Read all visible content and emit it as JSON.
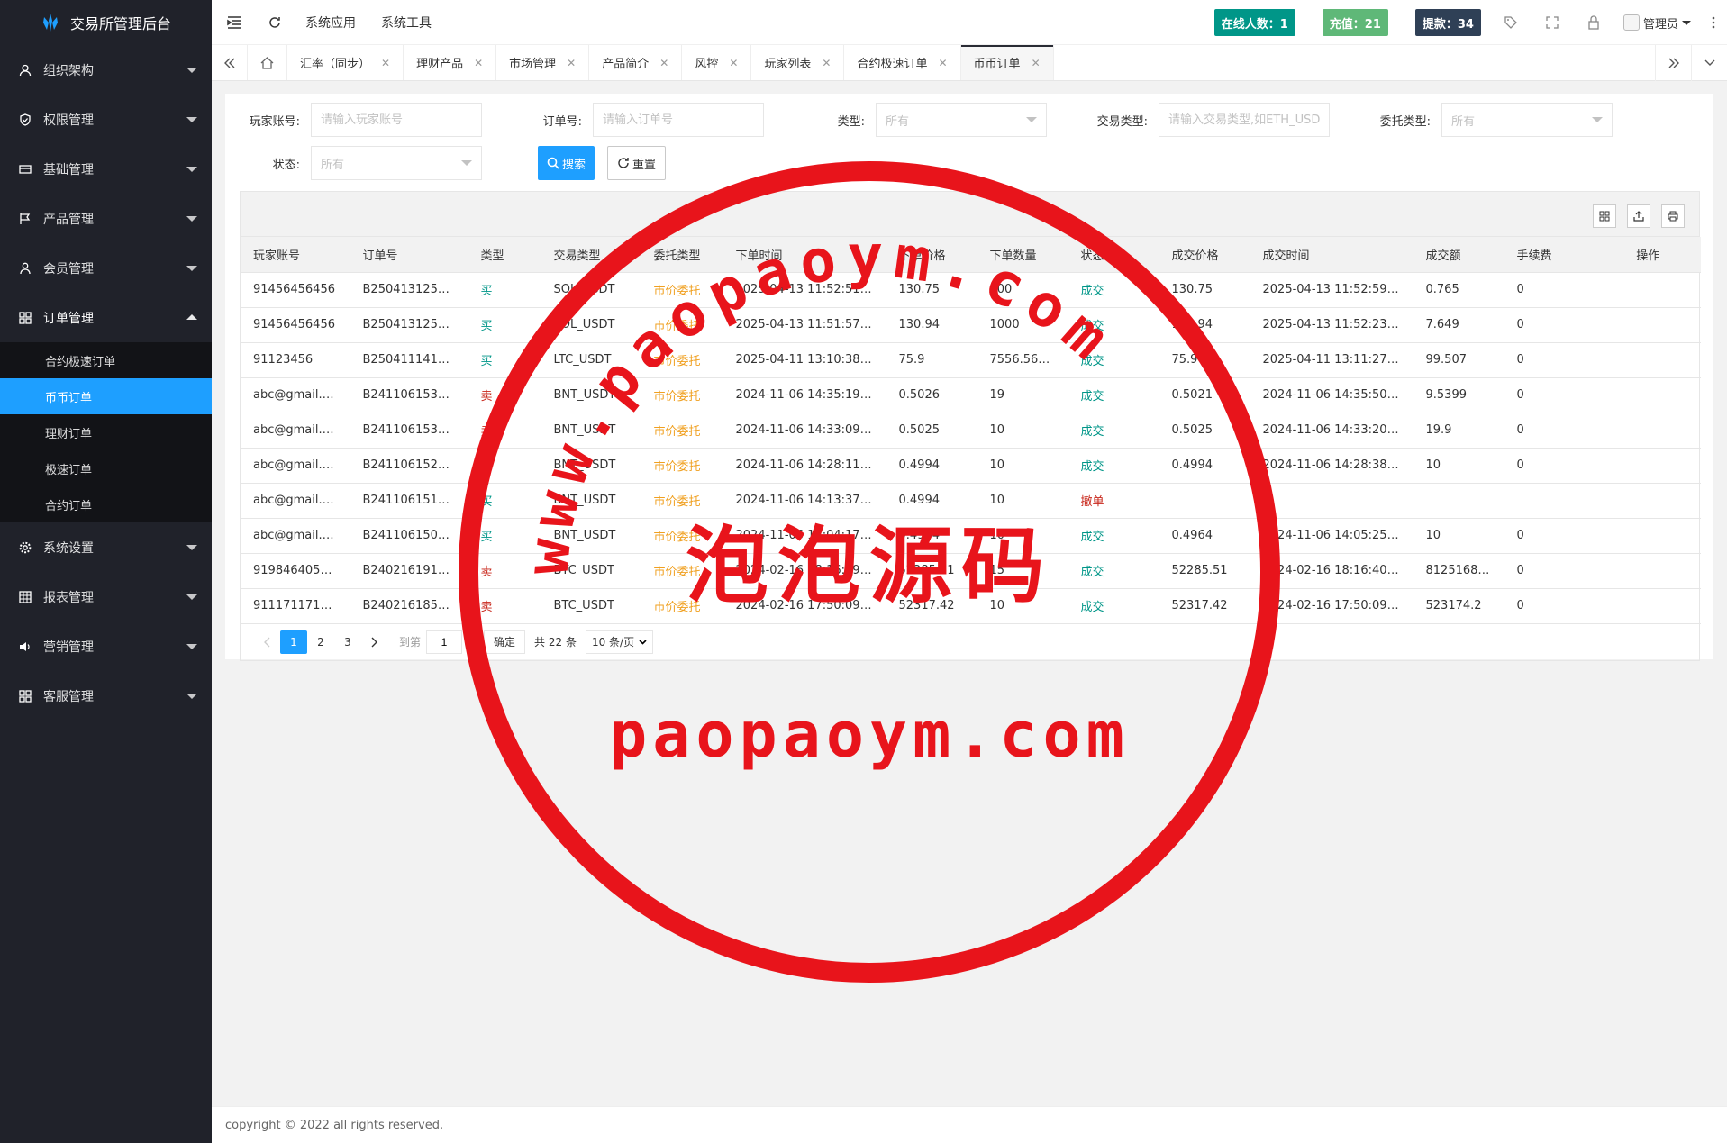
{
  "app": {
    "title": "交易所管理后台"
  },
  "sidebar": {
    "groups": [
      {
        "label": "组织架构",
        "icon": "user-icon"
      },
      {
        "label": "权限管理",
        "icon": "shield-icon"
      },
      {
        "label": "基础管理",
        "icon": "card-icon"
      },
      {
        "label": "产品管理",
        "icon": "flag-icon"
      },
      {
        "label": "会员管理",
        "icon": "person-icon"
      },
      {
        "label": "订单管理",
        "icon": "apps-icon",
        "open": true,
        "children": [
          "合约极速订单",
          "币币订单",
          "理财订单",
          "极速订单",
          "合约订单"
        ],
        "active_child": "币币订单"
      },
      {
        "label": "系统设置",
        "icon": "gear-icon"
      },
      {
        "label": "报表管理",
        "icon": "grid-icon"
      },
      {
        "label": "营销管理",
        "icon": "speaker-icon"
      },
      {
        "label": "客服管理",
        "icon": "apps-icon"
      }
    ]
  },
  "header": {
    "menu1": "系统应用",
    "menu2": "系统工具",
    "online": "在线人数：1",
    "recharge": "充值：21",
    "withdraw": "提款：34",
    "user": "管理员",
    "colors": {
      "online": "#009688",
      "recharge": "#5fb878",
      "withdraw": "#2f4056"
    }
  },
  "tabs": [
    {
      "label": "汇率（同步）"
    },
    {
      "label": "理财产品"
    },
    {
      "label": "市场管理"
    },
    {
      "label": "产品简介"
    },
    {
      "label": "风控"
    },
    {
      "label": "玩家列表"
    },
    {
      "label": "合约极速订单"
    },
    {
      "label": "币币订单",
      "active": true
    }
  ],
  "form": {
    "player_label": "玩家账号:",
    "player_placeholder": "请输入玩家账号",
    "order_label": "订单号:",
    "order_placeholder": "请输入订单号",
    "type_label": "类型:",
    "type_value": "所有",
    "trade_label": "交易类型:",
    "trade_placeholder": "请输入交易类型,如ETH_USDT",
    "entrust_label": "委托类型:",
    "entrust_value": "所有",
    "status_label": "状态:",
    "status_value": "所有",
    "search_btn": "搜索",
    "reset_btn": "重置"
  },
  "table": {
    "columns": [
      "玩家账号",
      "订单号",
      "类型",
      "交易类型",
      "委托类型",
      "下单时间",
      "下单价格",
      "下单数量",
      "状态",
      "成交价格",
      "成交时间",
      "成交额",
      "手续费",
      "操作"
    ],
    "rows": [
      [
        "91456456456",
        "B250413125…",
        "买",
        "SOL_USDT",
        "市价委托",
        "2025-04-13 11:52:51.…",
        "130.75",
        "100",
        "成交",
        "130.75",
        "2025-04-13 11:52:59.…",
        "0.765",
        "0"
      ],
      [
        "91456456456",
        "B250413125…",
        "买",
        "SOL_USDT",
        "市价委托",
        "2025-04-13 11:51:57.…",
        "130.94",
        "1000",
        "成交",
        "130.94",
        "2025-04-13 11:52:23.…",
        "7.649",
        "0"
      ],
      [
        "91123456",
        "B2504111410…",
        "买",
        "LTC_USDT",
        "市价委托",
        "2025-04-11 13:10:38.…",
        "75.9",
        "7556.56…",
        "成交",
        "75.9",
        "2025-04-11 13:11:27.…",
        "99.507",
        "0"
      ],
      [
        "abc@gmail.…",
        "B241106153…",
        "卖",
        "BNT_USDT",
        "市价委托",
        "2024-11-06 14:35:19.…",
        "0.5026",
        "19",
        "成交",
        "0.5021",
        "2024-11-06 14:35:50.…",
        "9.5399",
        "0"
      ],
      [
        "abc@gmail.…",
        "B241106153…",
        "卖",
        "BNT_USDT",
        "市价委托",
        "2024-11-06 14:33:09.…",
        "0.5025",
        "10",
        "成交",
        "0.5025",
        "2024-11-06 14:33:20.…",
        "19.9",
        "0"
      ],
      [
        "abc@gmail.…",
        "B241106152…",
        "买",
        "BNT_USDT",
        "市价委托",
        "2024-11-06 14:28:11.…",
        "0.4994",
        "10",
        "成交",
        "0.4994",
        "2024-11-06 14:28:38.…",
        "10",
        "0"
      ],
      [
        "abc@gmail.…",
        "B241106151…",
        "买",
        "BNT_USDT",
        "市价委托",
        "2024-11-06 14:13:37.…",
        "0.4994",
        "10",
        "撤单",
        "",
        "",
        "",
        ""
      ],
      [
        "abc@gmail.…",
        "B241106150…",
        "买",
        "BNT_USDT",
        "市价委托",
        "2024-11-06 14:04:17.…",
        "0.4964",
        "10",
        "成交",
        "0.4964",
        "2024-11-06 14:05:25.…",
        "10",
        "0"
      ],
      [
        "919846405…",
        "B240216191…",
        "卖",
        "BTC_USDT",
        "市价委托",
        "2024-02-16 18:16:19.…",
        "52285.51",
        "15",
        "成交",
        "52285.51",
        "2024-02-16 18:16:40.…",
        "8125168…",
        "0"
      ],
      [
        "911171171171",
        "B240216185…",
        "卖",
        "BTC_USDT",
        "市价委托",
        "2024-02-16 17:50:09.…",
        "52317.42",
        "10",
        "成交",
        "52317.42",
        "2024-02-16 17:50:09.…",
        "523174.2",
        "0"
      ]
    ]
  },
  "pager": {
    "pages": [
      "1",
      "2",
      "3"
    ],
    "goto_label": "到第",
    "goto_value": "1",
    "page_suffix": "页",
    "confirm": "确定",
    "total": "共 22 条",
    "limit": "10 条/页"
  },
  "footer": {
    "text": "copyright © 2022 all rights reserved."
  },
  "watermark": {
    "arc_text": "www.paopaoym.com",
    "cn_text": "泡泡源码",
    "bottom_text": "paopaoym.com",
    "color": "#e8141b"
  }
}
